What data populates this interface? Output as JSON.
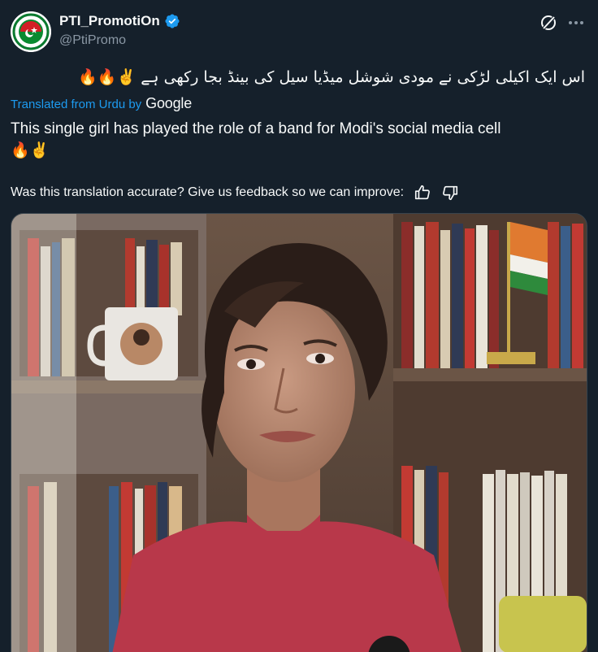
{
  "post": {
    "display_name": "PTI_PromotiOn",
    "handle": "@PtiPromo",
    "original_text": "اس ایک اکیلی لڑکی نے مودی شوشل میڈیا سیل کی بینڈ بجا رکھی ہے ✌️🔥🔥",
    "translated_from": "Translated from Urdu by",
    "translator": "Google",
    "translation_line1": "This single girl has played the role of a band for Modi's social media cell",
    "translation_line2": "🔥✌️",
    "feedback_prompt": "Was this translation accurate? Give us feedback so we can improve:"
  },
  "icons": {
    "verified": "verified-badge-icon",
    "grok": "grok-icon",
    "more": "more-options-icon",
    "thumbs_up": "thumbs-up-icon",
    "thumbs_down": "thumbs-down-icon"
  },
  "colors": {
    "background": "#15202b",
    "accent": "#1d9bf0",
    "secondary_text": "#8b98a5",
    "primary_text": "#f7f9f9"
  }
}
